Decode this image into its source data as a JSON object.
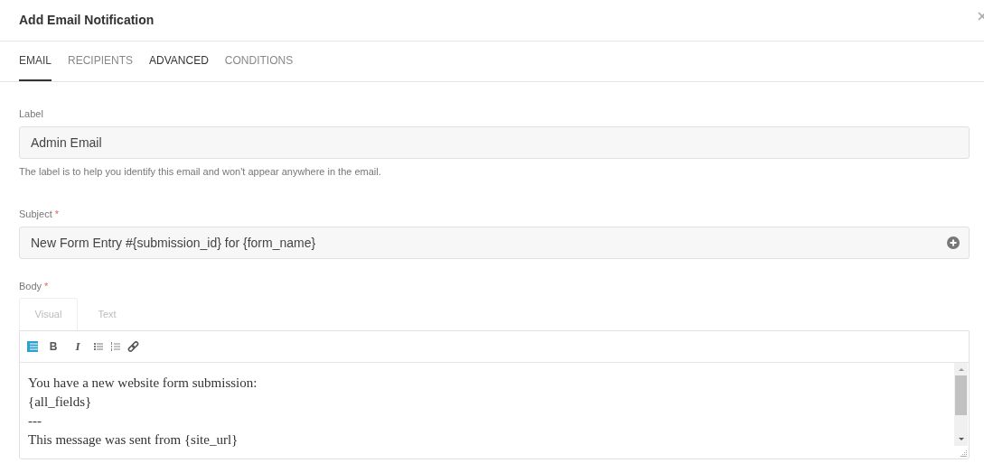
{
  "dialog": {
    "title": "Add Email Notification"
  },
  "tabs": [
    {
      "label": "EMAIL",
      "selected": true,
      "highlighted": false
    },
    {
      "label": "RECIPIENTS",
      "selected": false,
      "highlighted": false
    },
    {
      "label": "ADVANCED",
      "selected": false,
      "highlighted": true
    },
    {
      "label": "CONDITIONS",
      "selected": false,
      "highlighted": false
    }
  ],
  "label_field": {
    "label": "Label",
    "value": "Admin Email",
    "help": "The label is to help you identify this email and won't appear anywhere in the email."
  },
  "subject_field": {
    "label": "Subject",
    "required_mark": "*",
    "value": "New Form Entry #{submission_id} for {form_name}"
  },
  "body_field": {
    "label": "Body",
    "required_mark": "*",
    "editor_tabs": [
      {
        "label": "Visual",
        "selected": true
      },
      {
        "label": "Text",
        "selected": false
      }
    ],
    "toolbar": [
      {
        "kind": "toggle"
      },
      {
        "kind": "bold",
        "label": "B"
      },
      {
        "kind": "italic",
        "label": "I"
      },
      {
        "kind": "bullets"
      },
      {
        "kind": "numbers"
      },
      {
        "kind": "link"
      }
    ],
    "lines": [
      "You have a new website form submission:",
      "{all_fields}",
      "---",
      "This message was sent from {site_url}"
    ]
  }
}
